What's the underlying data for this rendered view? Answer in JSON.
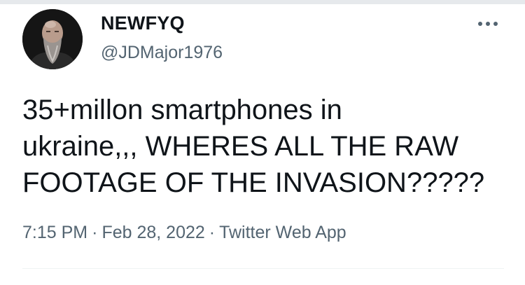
{
  "author": {
    "display_name": "NEWFYQ",
    "handle": "@JDMajor1976",
    "avatar_icon": "profile-photo-bearded-man"
  },
  "more_icon": "more-horizontal-icon",
  "tweet": {
    "text_lines": [
      "35+millon smartphones in",
      "ukraine,,, WHERES ALL THE RAW",
      "FOOTAGE OF THE INVASION?????"
    ]
  },
  "meta": {
    "time": "7:15 PM",
    "date": "Feb 28, 2022",
    "source": "Twitter Web App",
    "separator": "·"
  },
  "colors": {
    "text": "#0f1419",
    "secondary": "#536471",
    "divider": "#eff3f4"
  }
}
